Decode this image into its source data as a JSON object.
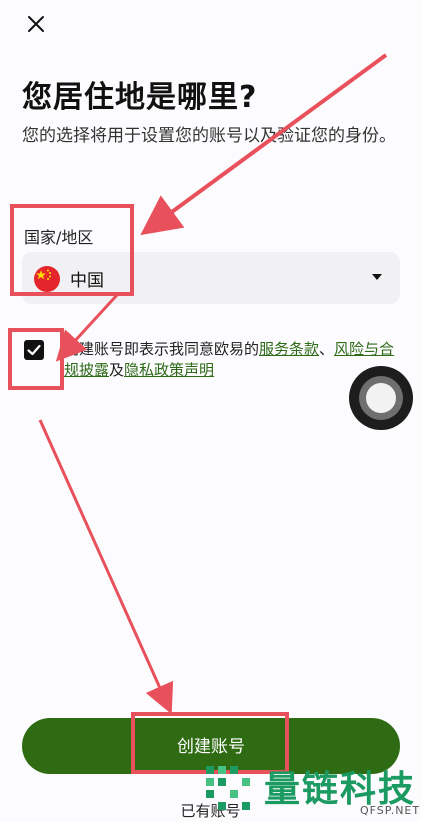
{
  "header": {
    "close_icon": "close-icon"
  },
  "title": "您居住地是哪里?",
  "subtitle": "您的选择将用于设置您的账号以及验证您的身份。",
  "country": {
    "label": "国家/地区",
    "value": "中国",
    "flag_icon": "china-flag-icon"
  },
  "agreement": {
    "checked": true,
    "prefix": "创建账号即表示我同意欧易的",
    "link_terms": "服务条款",
    "sep1": "、",
    "link_risk": "风险与合规披露",
    "sep2": "及",
    "link_privacy": "隐私政策声明"
  },
  "primary_button": {
    "label": "创建账号",
    "color": "#2e6b12"
  },
  "footer": {
    "login_text": "已有账号"
  },
  "watermark": {
    "text": "量链科技",
    "sub": "QFSP.NET"
  },
  "annotation_color": "#e8515c"
}
